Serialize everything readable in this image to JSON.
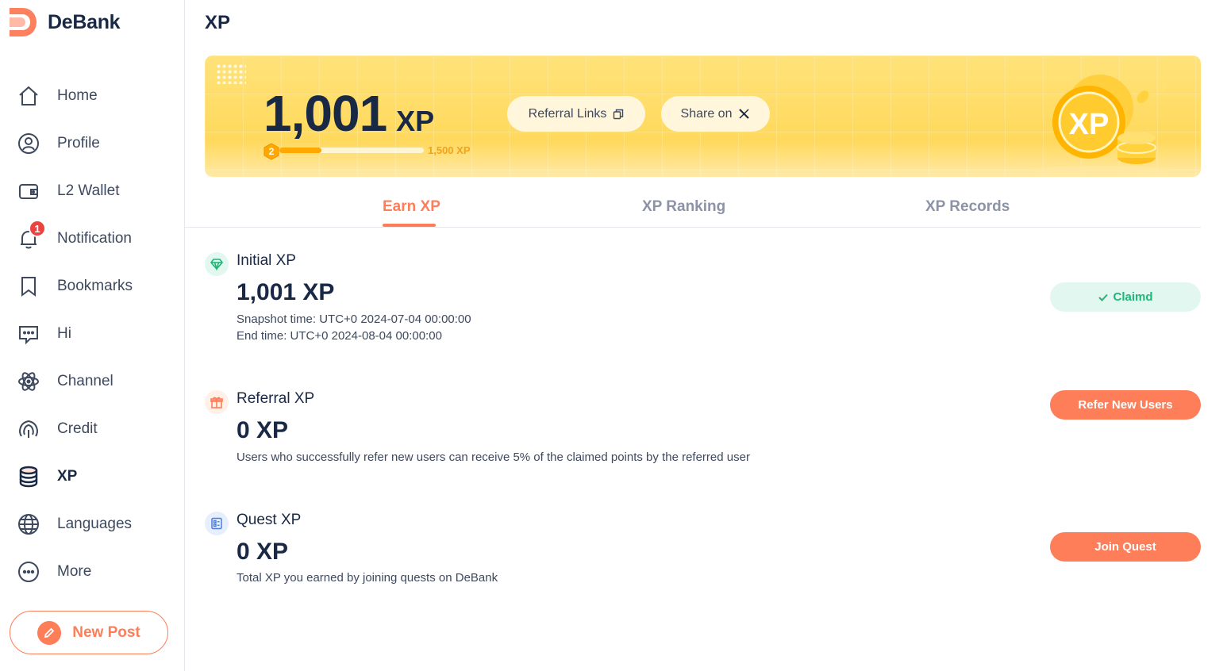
{
  "app": {
    "name": "DeBank"
  },
  "sidebar": {
    "items": [
      {
        "label": "Home",
        "icon": "home-icon"
      },
      {
        "label": "Profile",
        "icon": "profile-icon"
      },
      {
        "label": "L2 Wallet",
        "icon": "wallet-icon"
      },
      {
        "label": "Notification",
        "icon": "bell-icon",
        "badge": "1"
      },
      {
        "label": "Bookmarks",
        "icon": "bookmark-icon"
      },
      {
        "label": "Hi",
        "icon": "message-icon"
      },
      {
        "label": "Channel",
        "icon": "atom-icon"
      },
      {
        "label": "Credit",
        "icon": "credit-icon"
      },
      {
        "label": "XP",
        "icon": "database-icon",
        "active": true
      },
      {
        "label": "Languages",
        "icon": "globe-icon"
      },
      {
        "label": "More",
        "icon": "more-icon"
      }
    ],
    "new_post_label": "New Post"
  },
  "page": {
    "title": "XP"
  },
  "banner": {
    "xp_value": "1,001",
    "xp_unit": "XP",
    "level": "2",
    "progress_fraction": 0.29,
    "next_level_label": "1,500 XP",
    "referral_button": "Referral Links",
    "share_button": "Share on",
    "coin_text": "XP"
  },
  "tabs": [
    {
      "label": "Earn XP",
      "active": true
    },
    {
      "label": "XP Ranking"
    },
    {
      "label": "XP Records"
    }
  ],
  "sections": {
    "initial": {
      "title": "Initial XP",
      "value": "1,001 XP",
      "snapshot": "Snapshot time: UTC+0 2024-07-04 00:00:00",
      "end": "End time: UTC+0 2024-08-04 00:00:00",
      "button": "Claimd"
    },
    "referral": {
      "title": "Referral XP",
      "value": "0 XP",
      "desc": "Users who successfully refer new users can receive 5% of the claimed points by the referred user",
      "button": "Refer New Users"
    },
    "quest": {
      "title": "Quest XP",
      "value": "0 XP",
      "desc": "Total XP you earned by joining quests on DeBank",
      "button": "Join Quest"
    }
  },
  "colors": {
    "accent": "#fd7e59",
    "text_dark": "#192945",
    "claimed_bg": "#e2f7ef",
    "claimed_text": "#1fb678",
    "banner_yellow": "#ffd95c"
  }
}
